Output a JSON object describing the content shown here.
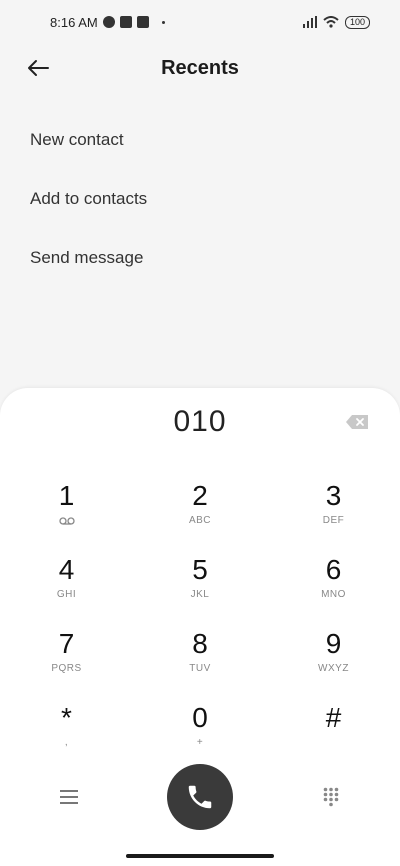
{
  "status": {
    "time": "8:16 AM",
    "battery": "100"
  },
  "header": {
    "title": "Recents"
  },
  "menu": {
    "items": [
      {
        "label": "New contact"
      },
      {
        "label": "Add to contacts"
      },
      {
        "label": "Send message"
      }
    ]
  },
  "dialpad": {
    "number": "010",
    "keys": [
      {
        "digit": "1",
        "letters": ""
      },
      {
        "digit": "2",
        "letters": "ABC"
      },
      {
        "digit": "3",
        "letters": "DEF"
      },
      {
        "digit": "4",
        "letters": "GHI"
      },
      {
        "digit": "5",
        "letters": "JKL"
      },
      {
        "digit": "6",
        "letters": "MNO"
      },
      {
        "digit": "7",
        "letters": "PQRS"
      },
      {
        "digit": "8",
        "letters": "TUV"
      },
      {
        "digit": "9",
        "letters": "WXYZ"
      },
      {
        "digit": "*",
        "letters": ","
      },
      {
        "digit": "0",
        "letters": "+"
      },
      {
        "digit": "#",
        "letters": ""
      }
    ]
  },
  "colors": {
    "background": "#f5f5f5",
    "call_button": "#3a3a3a"
  },
  "icons": [
    "back-arrow-icon",
    "backspace-icon",
    "voicemail-icon",
    "phone-icon",
    "menu-lines-icon",
    "dialpad-grid-icon"
  ]
}
